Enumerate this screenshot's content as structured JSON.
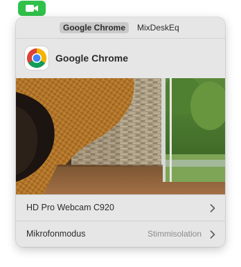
{
  "menu_bar": {
    "indicator_icon": "video-camera-icon",
    "indicator_color": "#30c14a"
  },
  "tabs": [
    {
      "label": "Google Chrome",
      "active": true
    },
    {
      "label": "MixDeskEq",
      "active": false
    }
  ],
  "app": {
    "name": "Google Chrome",
    "icon": "chrome-logo-icon"
  },
  "preview": {
    "description_icon": "camera-preview-image"
  },
  "camera_row": {
    "label": "HD Pro Webcam C920",
    "icon": "chevron-right-icon"
  },
  "mic_row": {
    "label": "Mikrofonmodus",
    "value": "Stimmisolation",
    "icon": "chevron-right-icon"
  }
}
